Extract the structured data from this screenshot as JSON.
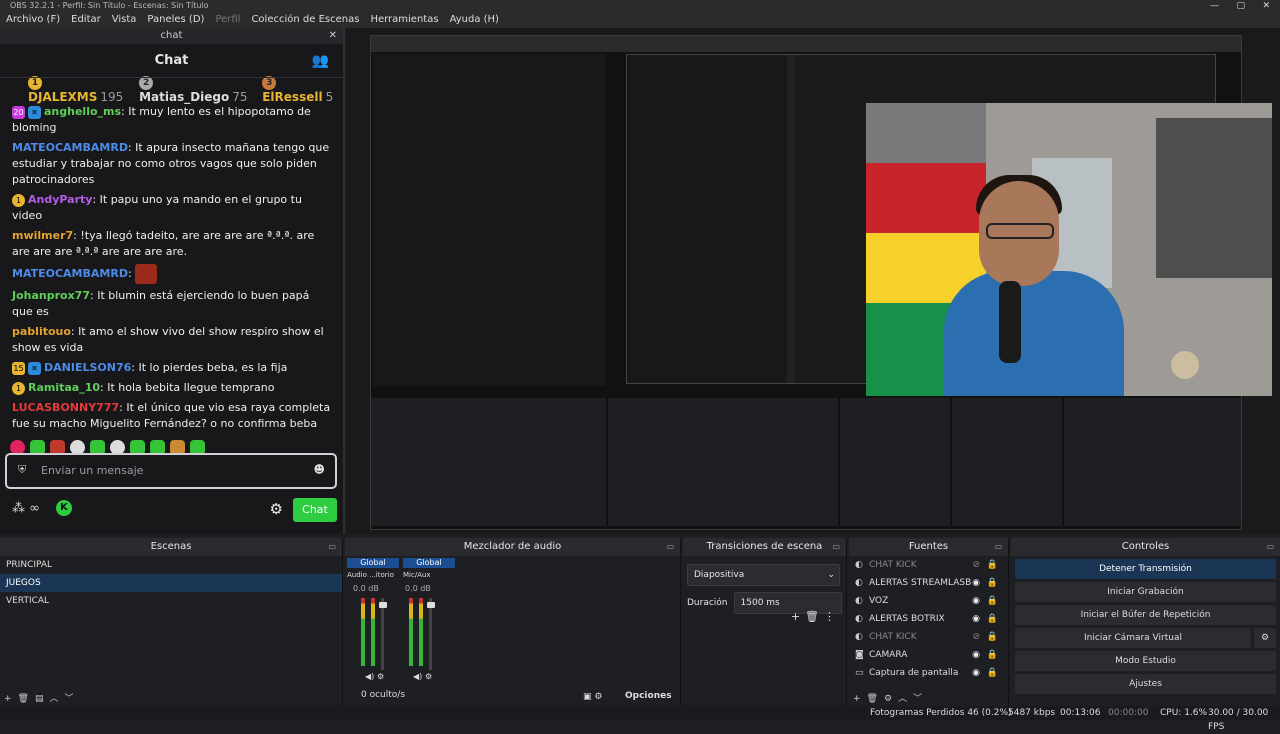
{
  "window": {
    "title": "OBS 32.2.1 - Perfil: Sin Título - Escenas: Sin Título"
  },
  "menu": [
    "Archivo (F)",
    "Editar",
    "Vista",
    "Paneles (D)",
    "Perfil",
    "Colección de Escenas",
    "Herramientas",
    "Ayuda (H)"
  ],
  "chat_dock": {
    "title": "chat",
    "header": "Chat",
    "leaders": [
      {
        "rank": "1",
        "name": "DJALEXMS",
        "points": "195"
      },
      {
        "rank": "2",
        "name": "Matias_Diego",
        "points": "75"
      },
      {
        "rank": "3",
        "name": "ElRessell",
        "points": "5"
      }
    ],
    "messages": [
      {
        "badge": "20",
        "user": "anghello_ms",
        "text": ": It muy lento es el hipopotamo de bloming",
        "color": "#5fcf59"
      },
      {
        "badge": "",
        "user": "MATEOCAMBAMRD",
        "text": ": It apura insecto mañana tengo que estudiar y trabajar no como otros vagos que solo piden patrocinadores",
        "color": "#4c8ce8"
      },
      {
        "badge": "1",
        "user": "AndyParty",
        "text": ": It papu uno ya mando en el grupo tu video",
        "color": "#b55ce6"
      },
      {
        "badge": "",
        "user": "mwilmer7",
        "text": ": !tya llegó tadeito, are are are are ª.ª.ª. are are are are ª.ª.ª are are are are.",
        "color": "#e6a130"
      },
      {
        "badge": "",
        "user": "MATEOCAMBAMRD",
        "text": ":",
        "color": "#4c8ce8"
      },
      {
        "badge": "",
        "user": "Johanprox77",
        "text": ": It blumin está ejerciendo lo buen papá que es",
        "color": "#5fcf59"
      },
      {
        "badge": "",
        "user": "pablitouo",
        "text": ": It amo el show vivo del show respiro show el show es vida",
        "color": "#e6a130"
      },
      {
        "badge": "15",
        "user": "DANIELSON76",
        "text": ": It lo pierdes beba, es la fija",
        "color": "#4c8ce8"
      },
      {
        "badge": "1",
        "user": "Ramitaa_10",
        "text": ": It hola bebita llegue temprano",
        "color": "#5fcf59"
      },
      {
        "badge": "",
        "user": "LUCASBONNY777",
        "text": ": It el único que vio esa raya completa fue su macho Miguelito Fernández? o no confirma beba",
        "color": "#e63a3a"
      }
    ],
    "input_placeholder": "Enviar un mensaje",
    "chat_button": "Chat"
  },
  "scenes": {
    "title": "Escenas",
    "items": [
      "PRINCIPAL",
      "JUEGOS",
      "VERTICAL"
    ],
    "selected": 1
  },
  "mixer": {
    "title": "Mezclador de audio",
    "channels": [
      {
        "top": "Global",
        "name": "Audio ...itorio",
        "db": "0.0 dB"
      },
      {
        "top": "Global",
        "name": "Mic/Aux",
        "db": "0.0 dB"
      }
    ],
    "hidden": "0 oculto/s",
    "options": "Opciones"
  },
  "transitions": {
    "title": "Transiciones de escena",
    "type": "Diapositiva",
    "duration_label": "Duración",
    "duration": "1500 ms"
  },
  "sources": {
    "title": "Fuentes",
    "items": [
      {
        "name": "CHAT KICK",
        "dim": true,
        "icon": "◐"
      },
      {
        "name": "ALERTAS STREAMLASB",
        "dim": false,
        "icon": "◐"
      },
      {
        "name": "VOZ",
        "dim": false,
        "icon": "◐"
      },
      {
        "name": "ALERTAS BOTRIX",
        "dim": false,
        "icon": "◐"
      },
      {
        "name": "CHAT KICK",
        "dim": true,
        "icon": "◐"
      },
      {
        "name": "CAMARA",
        "dim": false,
        "icon": "◙"
      },
      {
        "name": "Captura de pantalla",
        "dim": false,
        "icon": "▭"
      }
    ]
  },
  "controls": {
    "title": "Controles",
    "buttons": [
      "Detener Transmisión",
      "Iniciar Grabación",
      "Iniciar el Búfer de Repetición",
      "Iniciar Cámara Virtual",
      "Modo Estudio",
      "Ajustes"
    ]
  },
  "status": {
    "dropped": "Fotogramas Perdidos 46 (0.2%)",
    "kbps": "5487 kbps",
    "time1": "00:13:06",
    "time2": "00:00:00",
    "cpu": "CPU: 1.6%",
    "fps": "30.00 / 30.00 FPS"
  },
  "colors": {
    "accent": "#2ecc40",
    "selection": "#1b3654"
  }
}
